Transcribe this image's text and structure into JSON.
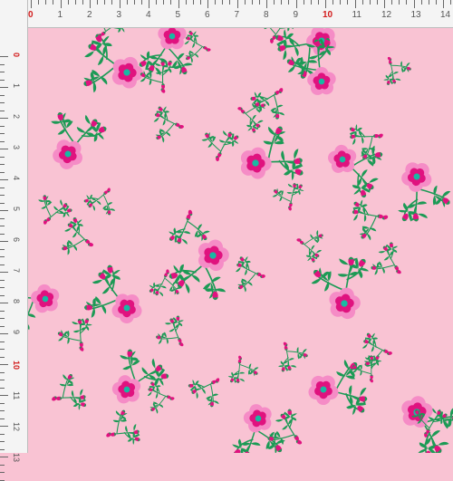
{
  "colors": {
    "background": "#f9c3d3",
    "petal_light": "#f58cc6",
    "petal_dark": "#e0127f",
    "center": "#18b9a3",
    "leaf": "#1c9a55",
    "ruler_bg": "#f4f4f4",
    "ruler_accent": "#d21c1c"
  },
  "ruler": {
    "top_numbers": [
      "0",
      "1",
      "2",
      "3",
      "4",
      "5",
      "6",
      "7",
      "8",
      "9",
      "10",
      "11",
      "12",
      "13",
      "14"
    ],
    "left_numbers": [
      "0",
      "1",
      "2",
      "3",
      "4",
      "5",
      "6",
      "7",
      "8",
      "9",
      "10",
      "11",
      "12",
      "13"
    ],
    "accent_numbers": [
      "0",
      "10"
    ]
  },
  "pattern": {
    "motif": "pink floral with small green leaves and buds",
    "icon": "flower-icon"
  }
}
